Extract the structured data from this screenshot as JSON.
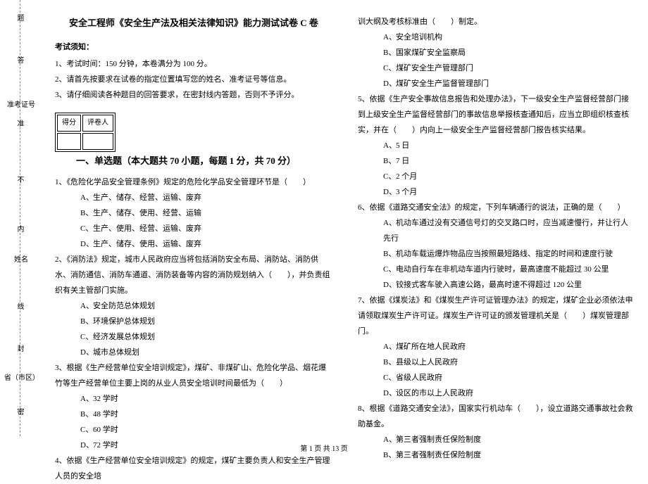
{
  "gutter": {
    "labels": {
      "school": "省（市区）",
      "name": "姓名",
      "ticket": "准考证号"
    },
    "marks": [
      "密",
      "封",
      "线",
      "内",
      "不",
      "准",
      "答",
      "题"
    ]
  },
  "title": "安全工程师《安全生产法及相关法律知识》能力测试试卷 C 卷",
  "notice_head": "考试须知：",
  "notices": [
    "1、考试时间：150 分钟，本卷满分为 100 分。",
    "2、请首先按要求在试卷的指定位置填写您的姓名、准考证号等信息。",
    "3、请仔细阅读各种题目的回答要求，在密封线内答题，否则不予评分。"
  ],
  "scorebox": {
    "c1": "得分",
    "c2": "评卷人"
  },
  "section_title": "一、单选题（本大题共 70 小题，每题 1 分，共 70 分）",
  "q1": {
    "stem": "1、《危险化学品安全管理条例》规定的危险化学品安全管理环节是（　　）",
    "opts": {
      "A": "生产、储存、经营、运输、废弃",
      "B": "生产、储存、使用、经营、运输",
      "C": "生产、使用、经营、运输、废弃",
      "D": "生产、储存、使用、运输、废弃"
    }
  },
  "q2": {
    "stem": "2、《消防法》规定，城市人民政府应当将包括消防安全布局、消防站、消防供水、消防通信、消防车通道、消防装备等内容的消防规划纳入（　　），并负责组织有关主管部门实施。",
    "opts": {
      "A": "安全防范总体规划",
      "B": "环境保护总体规划",
      "C": "经济发展总体规划",
      "D": "城市总体规划"
    }
  },
  "q3": {
    "stem": "3、根据《生产经营单位安全培训规定》，煤矿、非煤矿山、危险化学品、烟花爆竹等生产经营单位主要上岗的从业人员安全培训时间最低为（　　）",
    "opts": {
      "A": "32 学时",
      "B": "48 学时",
      "C": "60 学时",
      "D": "72 学时"
    }
  },
  "q4": {
    "stem_part": "4、依据《生产经营单位安全培训规定》的规定，煤矿主要负责人和安全生产管理人员的安全培",
    "cont": "训大纲及考核标准由（　　）制定。",
    "opts": {
      "A": "安全培训机构",
      "B": "国家煤矿安全监察局",
      "C": "煤矿安全生产管理部门",
      "D": "煤矿安全生产监督管理部门"
    }
  },
  "q5": {
    "stem": "5、依据《生产安全事故信息报告和处理办法》，下一级安全生产监督经营部门接到上级安全生产监督经营部门的事故信息举报核查通知后，应当立即组织核查核实，并在（　　）内向上一级安全生产监督经营部门报告核实结果。",
    "opts": {
      "A": "5 日",
      "B": "7 日",
      "C": "2 个月",
      "D": "3 个月"
    }
  },
  "q6": {
    "stem": "6、依据《道路交通安全法》的规定，下列车辆通行的说法，正确的是（　　）",
    "opts": {
      "A": "机动车通过没有交通信号灯的交叉路口时，应当减速慢行，并让行人先行",
      "B": "机动车载运爆炸物品应当按照最短路线、指定的时间和速度行驶",
      "C": "电动自行车在非机动车道内行驶时，最高速度不能超过 30 公里",
      "D": "铰接式客车驶入高速公路，最高时速不得超过 120 公里"
    }
  },
  "q7": {
    "stem": "7、依据《煤炭法》和《煤炭生产许可证管理办法》的规定，煤矿企业必须依法申请领取煤炭生产许可证。煤炭生产许可证的颁发管理机关是（　　）煤炭管理部门。",
    "opts": {
      "A": "煤矿所在地人民政府",
      "B": "县级以上人民政府",
      "C": "省级人民政府",
      "D": "设区的市以上人民政府"
    }
  },
  "q8": {
    "stem": "8、根据《道路交通安全法》，国家实行机动车（　　），设立道路交通事故社会救助基金。",
    "opts": {
      "A": "第三者强制责任保险制度",
      "B": "第三者强制责任保险制度"
    }
  },
  "footer": "第 1 页 共 13 页"
}
